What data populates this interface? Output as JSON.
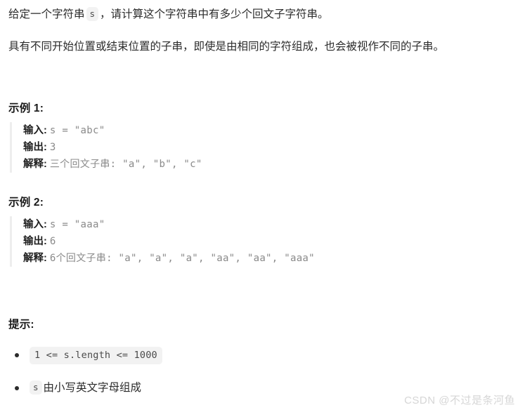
{
  "document": {
    "intro": {
      "line1_part1": "给定一个字符串",
      "line1_code": "s",
      "line1_part2": "，请计算这个字符串中有多少个回文子字符串。",
      "line2": "具有不同开始位置或结束位置的子串，即使是由相同的字符组成，也会被视作不同的子串。"
    },
    "examples": [
      {
        "heading": "示例 1:",
        "rows": [
          {
            "label": "输入:",
            "value": "s = \"abc\""
          },
          {
            "label": "输出:",
            "value": "3"
          },
          {
            "label": "解释:",
            "value": "三个回文子串: \"a\", \"b\", \"c\""
          }
        ]
      },
      {
        "heading": "示例 2:",
        "rows": [
          {
            "label": "输入:",
            "value": "s = \"aaa\""
          },
          {
            "label": "输出:",
            "value": "6"
          },
          {
            "label": "解释:",
            "value": "6个回文子串: \"a\", \"a\", \"a\", \"aa\", \"aa\", \"aaa\""
          }
        ]
      }
    ],
    "hints": {
      "heading": "提示:",
      "items": [
        {
          "code": "1 <= s.length <= 1000",
          "text": ""
        },
        {
          "code": "s",
          "text": "由小写英文字母组成"
        }
      ]
    },
    "watermark": "CSDN @不过是条河鱼",
    "colors": {
      "background": "#ffffff",
      "body_text": "#2b2b2b",
      "heading_text": "#1a1a1a",
      "code_value_text": "#8a8a8a",
      "chip_background": "#f2f2f2",
      "blockquote_border": "#eeeeee",
      "watermark_text": "#d6d6d6"
    }
  }
}
